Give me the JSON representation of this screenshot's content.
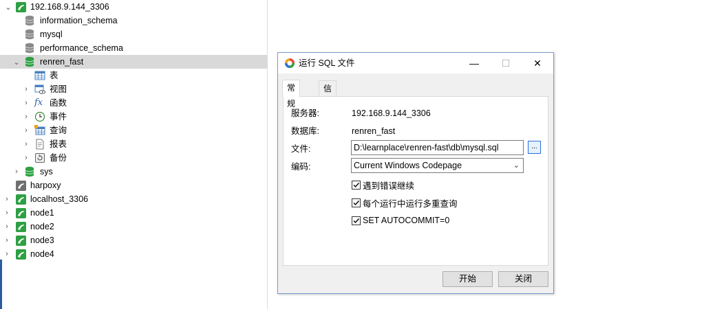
{
  "tree": {
    "connection": "192.168.9.144_3306",
    "databases": [
      "information_schema",
      "mysql",
      "performance_schema",
      "renren_fast"
    ],
    "renren_children": [
      "表",
      "视图",
      "函数",
      "事件",
      "查询",
      "报表",
      "备份"
    ],
    "sys": "sys",
    "other_connections": [
      "harpoxy",
      "localhost_3306",
      "node1",
      "node2",
      "node3",
      "node4"
    ],
    "function_icon": "fx"
  },
  "dialog": {
    "title": "运行 SQL 文件",
    "tabs": [
      "常规",
      "信息日志"
    ],
    "server_label": "服务器:",
    "server_value": "192.168.9.144_3306",
    "database_label": "数据库:",
    "database_value": "renren_fast",
    "file_label": "文件:",
    "file_value": "D:\\learnplace\\renren-fast\\db\\mysql.sql",
    "browse_label": "...",
    "encoding_label": "编码:",
    "encoding_value": "Current Windows Codepage",
    "checkboxes": [
      {
        "label": "遇到错误继续",
        "checked": true
      },
      {
        "label": "每个运行中运行多重查询",
        "checked": true
      },
      {
        "label": "SET AUTOCOMMIT=0",
        "checked": true
      }
    ],
    "start_button": "开始",
    "close_button": "关闭",
    "minimize_glyph": "—",
    "maximize_glyph": "☐",
    "close_glyph": "✕"
  },
  "colors": {
    "connection_green": "#2ea043",
    "connection_gray": "#6e6e6e",
    "accent_blue": "#2a6fdb",
    "selection": "#d9d9d9"
  }
}
